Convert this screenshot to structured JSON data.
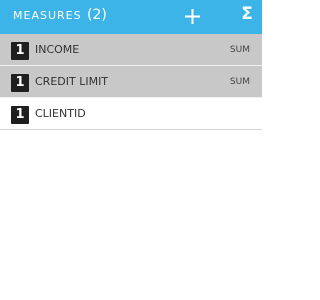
{
  "header": {
    "title": "MEASURES",
    "count": "(2)",
    "add_icon": "plus-icon",
    "sum_icon": "sigma-icon",
    "sigma_glyph": "Σ",
    "bg_color": "#3cb4e8"
  },
  "measures": [
    {
      "badge": "1",
      "label": "INCOME",
      "aggregation": "SUM",
      "selected": true
    },
    {
      "badge": "1",
      "label": "CREDIT LIMIT",
      "aggregation": "SUM",
      "selected": true
    },
    {
      "badge": "1",
      "label": "CLIENTID",
      "aggregation": "",
      "selected": false
    }
  ]
}
